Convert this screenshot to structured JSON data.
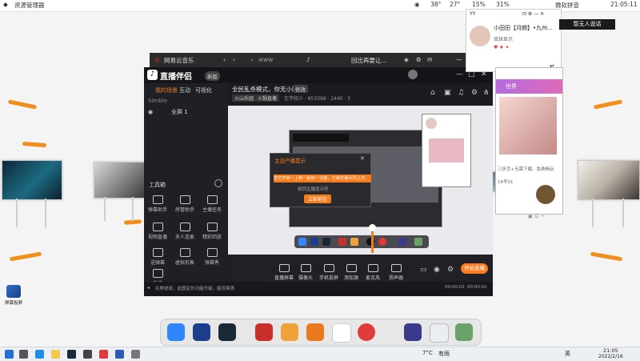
{
  "topbar": {
    "title": "资源管理器",
    "stats": [
      "38°",
      "27°",
      "15%",
      "31%"
    ],
    "app_label": "微软拼音",
    "time": "21:05:11"
  },
  "netease": {
    "title": "网易云音乐",
    "search_placeholder": "www",
    "user": "回出再要让..."
  },
  "app": {
    "title": "直播伴侣",
    "badge": "新版",
    "tabs": [
      "我的场景",
      "互动",
      "可视化"
    ],
    "scene_group": "Simble",
    "scene_item": "全屏 1",
    "stream_title": "全民乱杀模式，你无小团团",
    "stream_edit": "修改",
    "stream_cat1": "火山乐园",
    "stream_cat2": "火锅直播",
    "stream_meta": "在学校少 · 853368 · 2440 · 5",
    "tools_header": "工具箱",
    "tools": [
      "弹幕助手",
      "房管助手",
      "主播任务",
      "视频直播",
      "多人连麦",
      "精彩回放",
      "送弹幕",
      "虚拟形象",
      "弹幕秀",
      "直播"
    ],
    "bottom_buttons": [
      "直播屏幕",
      "摄像头",
      "手机投屏",
      "添加源",
      "麦克风",
      "扬声器"
    ],
    "mic_level": "100",
    "start_button": "开始直播",
    "status_text": "礼物说说，此固定长功能升级，能否够清",
    "timer": "00:00:02",
    "timer2": "00:00:02"
  },
  "dialog": {
    "title": "主设产播提示",
    "message": "您已开启一上和一起玩一功能，已锁定最大同上次。",
    "sub": "相同主播显示符",
    "button": "立即前往"
  },
  "chat": {
    "name": "小田田【月朗】•九州...",
    "sub": "双球显示",
    "toast": "暂无人说话"
  },
  "phone": {
    "banner": "世界",
    "line1": "三折页+无需下载，免费畅玩",
    "line2": "18号01"
  },
  "desktop_icon": {
    "label": "屏幕投屏"
  },
  "taskbar": {
    "temp": "7°C",
    "weather": "有雨",
    "ime": "英",
    "time": "21:05",
    "date": "2022/2/16"
  },
  "colors": {
    "accent": "#f57d1f",
    "orange_ray": "#f28d1a",
    "app_bg": "#1b1c20",
    "stream_button": "#ff7c1f"
  }
}
